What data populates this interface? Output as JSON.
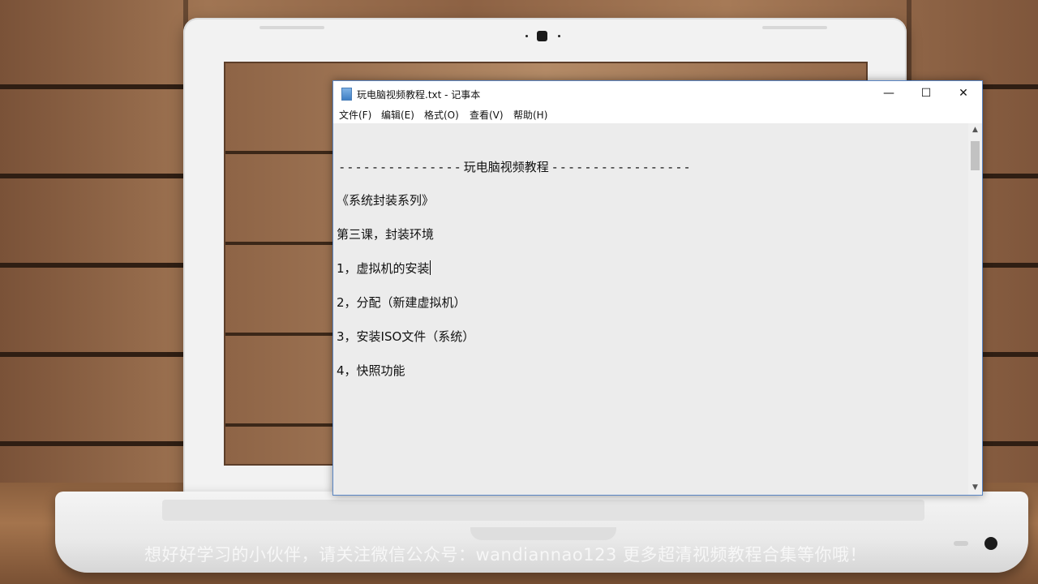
{
  "window": {
    "title": "玩电脑视频教程.txt - 记事本",
    "controls": {
      "minimize": "—",
      "maximize": "☐",
      "close": "✕"
    }
  },
  "menu": [
    {
      "label": "文件(F)"
    },
    {
      "label": "编辑(E)"
    },
    {
      "label": "格式(O)"
    },
    {
      "label": "查看(V)"
    },
    {
      "label": "帮助(H)"
    }
  ],
  "document": {
    "header_line": "- - - - - - - - - - - - - - - 玩电脑视频教程 - - - - - - - - - - - - - - - - -",
    "lines": [
      "《系统封装系列》",
      "第三课，封装环境",
      "1，虚拟机的安装",
      "2，分配（新建虚拟机）",
      "3，安装ISO文件（系统）",
      "4，快照功能"
    ]
  },
  "scrollbar": {
    "up": "▲",
    "down": "▼"
  },
  "watermark": "想好好学习的小伙伴，请关注微信公众号：wandiannao123 更多超清视频教程合集等你哦！",
  "icons": {
    "app": "notepad-icon",
    "minimize": "minimize-icon",
    "maximize": "maximize-icon",
    "close": "close-icon"
  }
}
